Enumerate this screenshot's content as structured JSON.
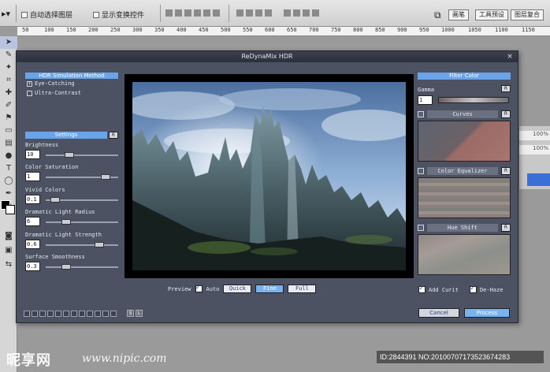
{
  "photoshop": {
    "tool_arrow": "▸▾",
    "auto_select_layer": "自动选择图层",
    "show_transform": "显示变换控件",
    "workspace_buttons": [
      "画笔",
      "工具预设",
      "图层复合"
    ],
    "ruler_ticks": [
      "50",
      "100",
      "150",
      "200",
      "250",
      "300",
      "350",
      "400",
      "450",
      "500",
      "550",
      "600",
      "650",
      "700",
      "750",
      "800",
      "850",
      "900",
      "950",
      "1000",
      "1050",
      "1100",
      "1150"
    ],
    "side_panel": [
      "100%",
      "100%"
    ]
  },
  "dialog": {
    "title": "ReDynaMix HDR",
    "close": "×",
    "left": {
      "method_header": "HDR Simulation Method",
      "modes": [
        {
          "label": "Eye-Catching",
          "mark": "+"
        },
        {
          "label": "Ultra-Contrast",
          "mark": ""
        }
      ],
      "settings_header": "Settings",
      "settings_btn": "R",
      "params": [
        {
          "label": "Brightness",
          "value": "10",
          "level": 0.3
        },
        {
          "label": "Color Saturation",
          "value": "1",
          "level": 0.88
        },
        {
          "label": "Vivid Colors",
          "value": "0.1",
          "level": 0.08
        },
        {
          "label": "Dramatic Light Radius",
          "value": "6",
          "level": 0.25
        },
        {
          "label": "Dramatic Light Strength",
          "value": "0.6",
          "level": 0.78
        },
        {
          "label": "Surface Smoothness",
          "value": "0.3",
          "level": 0.25
        }
      ],
      "icons": [
        "S",
        "L"
      ]
    },
    "preview": {
      "label": "Preview",
      "auto": "Auto",
      "buttons": [
        "Quick",
        "Fine",
        "Full"
      ],
      "active": "Fine"
    },
    "right": {
      "filter_header": "Filter Color",
      "gamma_label": "Gamma",
      "gamma_value": "1",
      "sections": [
        "Curves",
        "Color Equalizer",
        "Hue Shift"
      ],
      "reset": "R",
      "add_curves": "Add Curit",
      "de_haze": "De-Haze"
    },
    "buttons": {
      "cancel": "Cancel",
      "process": "Process"
    }
  },
  "watermark": {
    "logo": "昵享网",
    "url": "www.nipic.com",
    "id": "ID:2844391 NO:20100707173523674283"
  },
  "colors": {
    "dialog_bg": "#4d5262",
    "accent": "#6aa4e8",
    "sky": "#8fb0d6",
    "rock": "#4a6066"
  }
}
